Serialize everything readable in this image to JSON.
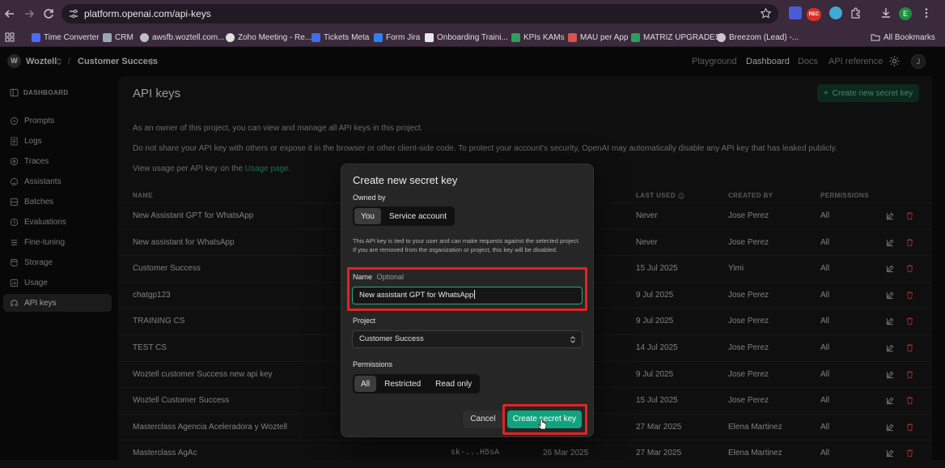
{
  "browser": {
    "url": "platform.openai.com/api-keys",
    "rec_label": "REC",
    "profile_initial": "E",
    "bookmarks": [
      "Time Converter",
      "CRM",
      "awsfb.woztell.com...",
      "Zoho Meeting - Re...",
      "Tickets Meta",
      "Form Jira",
      "Onboarding Traini...",
      "KPIs KAMs",
      "MAU per App",
      "MATRIZ UPGRADES",
      "Breezom (Lead) -...",
      "All Bookmarks"
    ]
  },
  "header": {
    "logo_letter": "W",
    "org": "Woztell",
    "separator": "/",
    "project": "Customer Success",
    "nav": [
      "Playground",
      "Dashboard",
      "Docs",
      "API reference"
    ],
    "avatar_initial": "J"
  },
  "sidebar": {
    "heading": "DASHBOARD",
    "items": [
      {
        "label": "Prompts",
        "icon": "prompt-icon"
      },
      {
        "label": "Logs",
        "icon": "logs-icon"
      },
      {
        "label": "Traces",
        "icon": "traces-icon"
      },
      {
        "label": "Assistants",
        "icon": "assistant-icon"
      },
      {
        "label": "Batches",
        "icon": "batches-icon"
      },
      {
        "label": "Evaluations",
        "icon": "evaluations-icon"
      },
      {
        "label": "Fine-tuning",
        "icon": "fine-tuning-icon"
      },
      {
        "label": "Storage",
        "icon": "storage-icon"
      },
      {
        "label": "Usage",
        "icon": "usage-icon"
      },
      {
        "label": "API keys",
        "icon": "key-icon"
      }
    ]
  },
  "main": {
    "title": "API keys",
    "create_button": "Create new secret key",
    "desc1": "As an owner of this project, you can view and manage all API keys in this project.",
    "desc2": "Do not share your API key with others or expose it in the browser or other client-side code. To protect your account's security, OpenAI may automatically disable any API key that has leaked publicly.",
    "desc3_prefix": "View usage per API key on the ",
    "desc3_link": "Usage page",
    "desc3_suffix": ".",
    "columns": {
      "name": "NAME",
      "last_used": "LAST USED",
      "created_by": "CREATED BY",
      "permissions": "PERMISSIONS"
    },
    "rows": [
      {
        "name": "New Assistant GPT for WhatsApp",
        "key": "",
        "created": "",
        "last_used": "Never",
        "created_by": "Jose Perez",
        "permissions": "All"
      },
      {
        "name": "New assistant for WhatsApp",
        "key": "",
        "created": "",
        "last_used": "Never",
        "created_by": "Jose Perez",
        "permissions": "All"
      },
      {
        "name": "Customer Success",
        "key": "",
        "created": "",
        "last_used": "15 Jul 2025",
        "created_by": "Yimi",
        "permissions": "All"
      },
      {
        "name": "chatgp123",
        "key": "",
        "created": "",
        "last_used": "9 Jul 2025",
        "created_by": "Jose Perez",
        "permissions": "All"
      },
      {
        "name": "TRAINING CS",
        "key": "",
        "created": "",
        "last_used": "9 Jul 2025",
        "created_by": "Jose Perez",
        "permissions": "All"
      },
      {
        "name": "TEST CS",
        "key": "",
        "created": "",
        "last_used": "14 Jul 2025",
        "created_by": "Jose Perez",
        "permissions": "All"
      },
      {
        "name": "Woztell customer Success new api key",
        "key": "",
        "created": "",
        "last_used": "9 Jul 2025",
        "created_by": "Jose Perez",
        "permissions": "All"
      },
      {
        "name": "Woztell Customer Success",
        "key": "",
        "created": "",
        "last_used": "15 Jul 2025",
        "created_by": "Jose Perez",
        "permissions": "All"
      },
      {
        "name": "Masterclass Agencia Aceleradora y Woztell",
        "key": "",
        "created": "",
        "last_used": "27 Mar 2025",
        "created_by": "Elena Martinez",
        "permissions": "All"
      },
      {
        "name": "Masterclass AgAc",
        "key": "sk-...H5sA",
        "created": "26 Mar 2025",
        "last_used": "27 Mar 2025",
        "created_by": "Elena Martinez",
        "permissions": "All"
      }
    ]
  },
  "modal": {
    "title": "Create new secret key",
    "owned_by_label": "Owned by",
    "owned_options": [
      "You",
      "Service account"
    ],
    "help": "This API key is tied to your user and can make requests against the selected project. If you are removed from the organization or project, this key will be disabled.",
    "name_label": "Name",
    "name_optional": "Optional",
    "name_value": "New assistant GPT for WhatsApp",
    "project_label": "Project",
    "project_value": "Customer Success",
    "permissions_label": "Permissions",
    "permission_options": [
      "All",
      "Restricted",
      "Read only"
    ],
    "cancel": "Cancel",
    "create": "Create secret key"
  }
}
